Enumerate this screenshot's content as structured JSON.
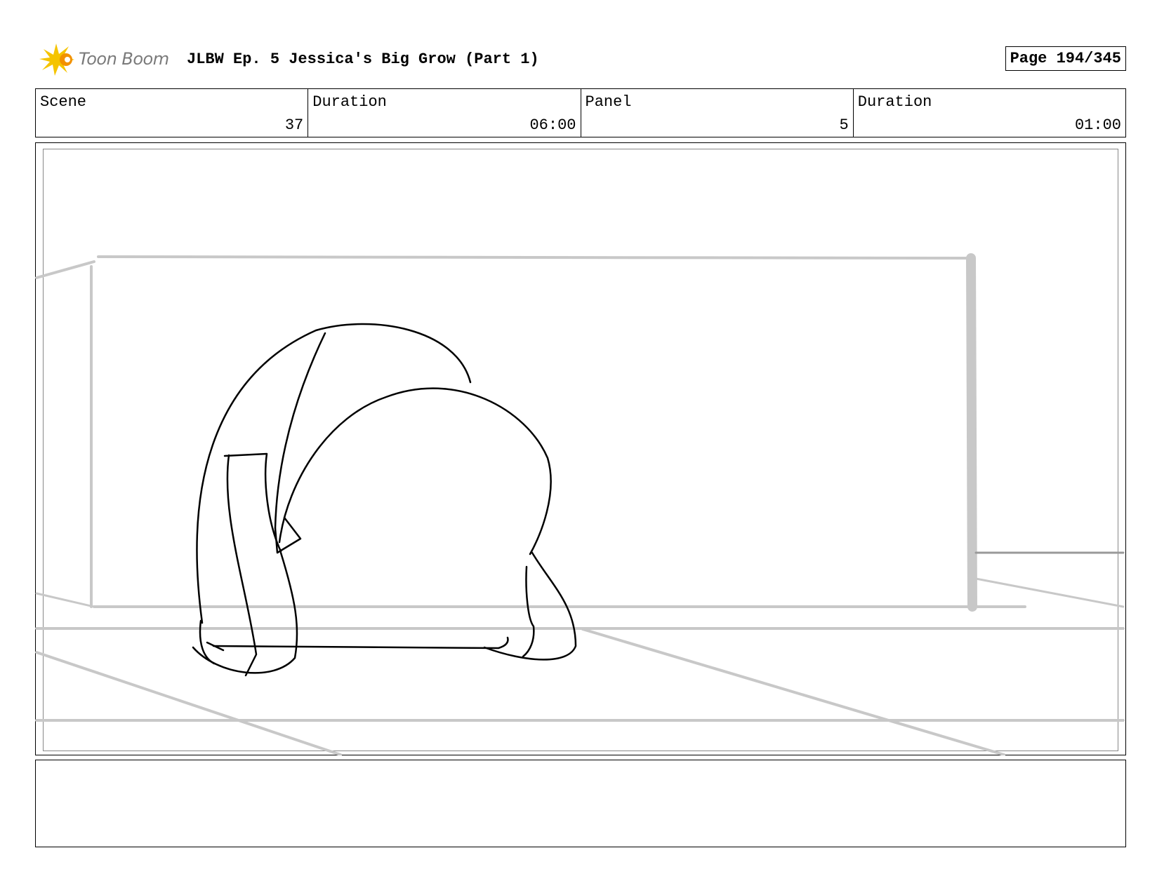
{
  "header": {
    "logo_text": "Toon Boom",
    "title": "JLBW Ep. 5 Jessica's Big Grow (Part 1)",
    "page": "Page 194/345"
  },
  "info": {
    "scene_label": "Scene",
    "scene_value": "37",
    "scene_duration_label": "Duration",
    "scene_duration_value": "06:00",
    "panel_label": "Panel",
    "panel_value": "5",
    "panel_duration_label": "Duration",
    "panel_duration_value": "01:00"
  },
  "notes": {
    "text": ""
  },
  "colors": {
    "logo_yellow": "#f5c400",
    "logo_orange": "#f29100",
    "background_lines": "#c8c8c8"
  }
}
